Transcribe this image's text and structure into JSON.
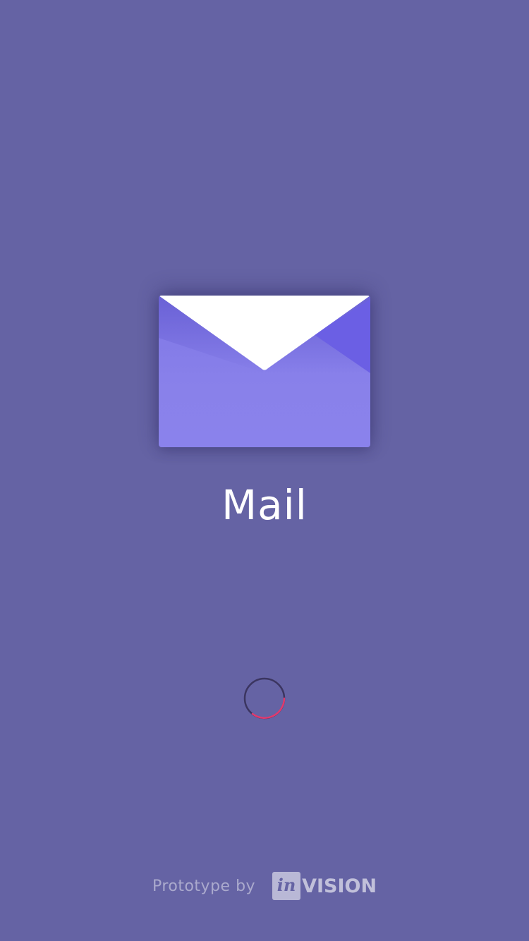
{
  "app": {
    "title": "Mail",
    "icon": "mail-envelope-icon",
    "background_color": "#6563a4",
    "icon_color": "#8a80ec",
    "icon_accent_color": "#6b5fe4"
  },
  "loading": {
    "icon": "loading-spinner-icon",
    "track_color": "#3b3560",
    "accent_color": "#e03a6e"
  },
  "footer": {
    "text": "Prototype by",
    "brand_box": "in",
    "brand_rest": "VISION"
  }
}
